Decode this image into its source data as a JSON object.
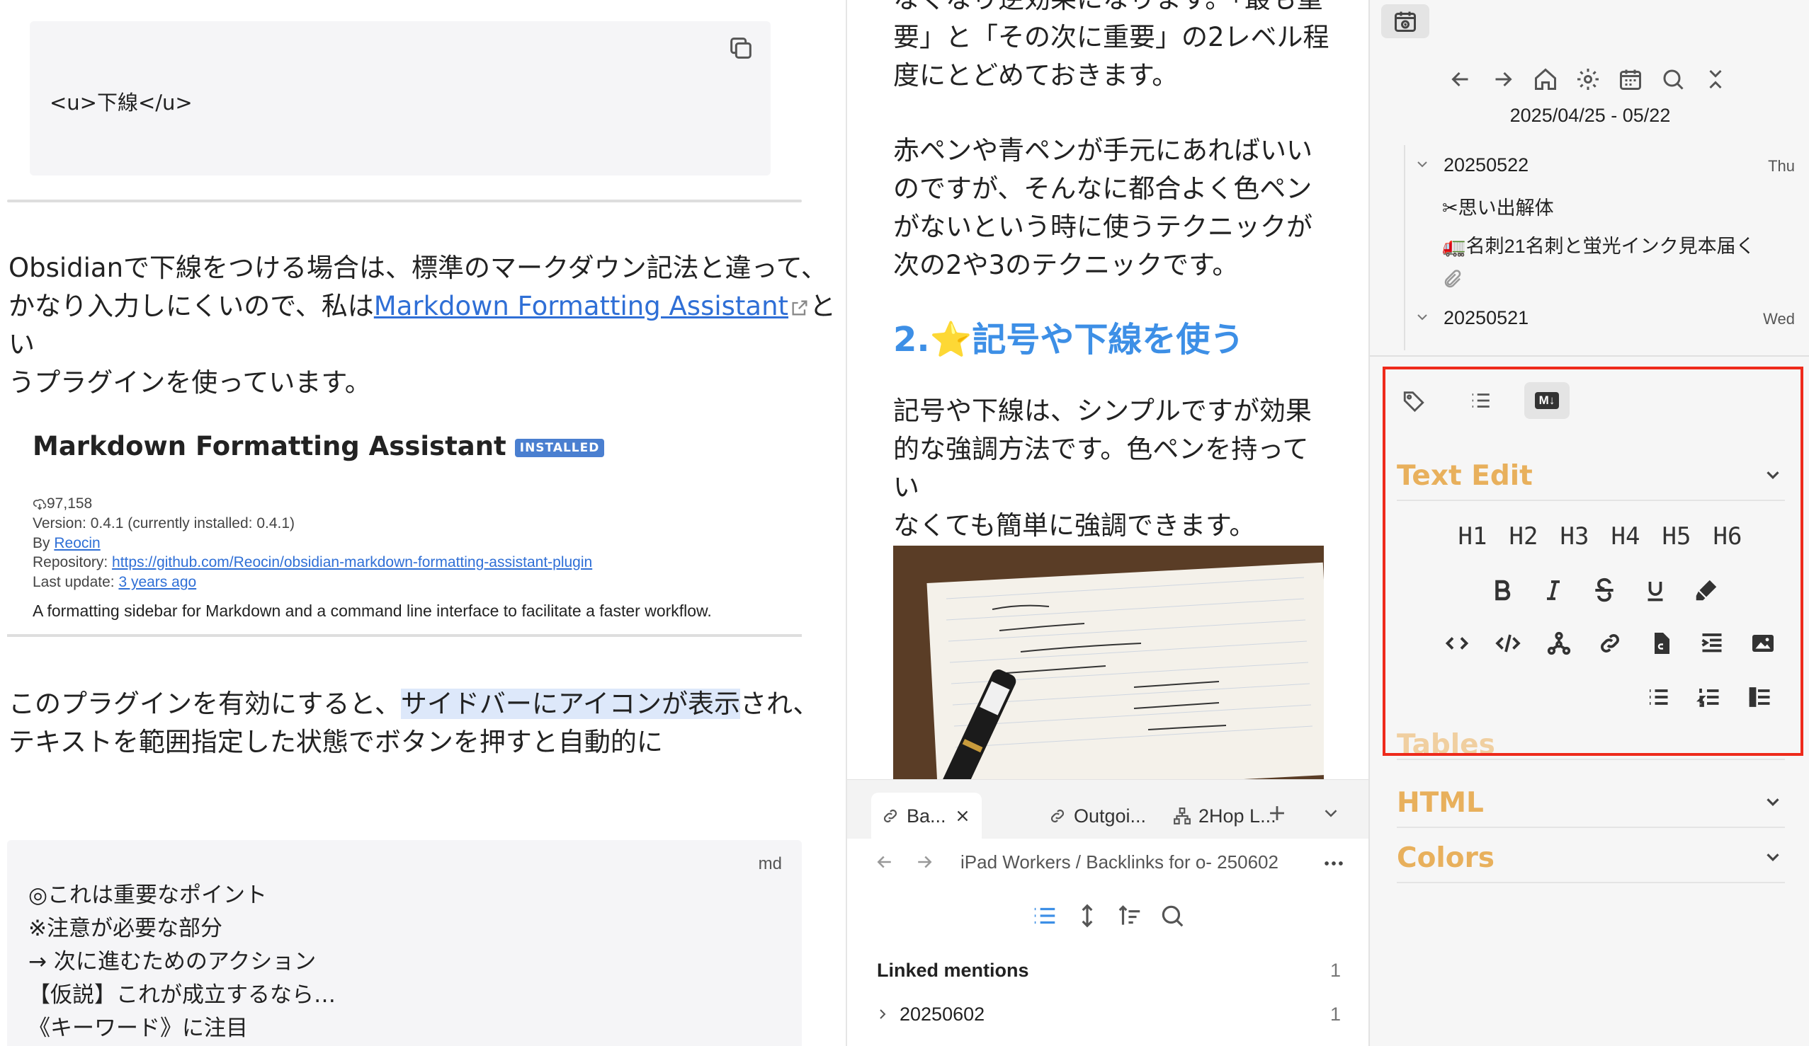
{
  "left": {
    "code1": "<u>下線</u>",
    "para1_a": "Obsidianで下線をつける場合は、標準のマークダウン記法と違って、",
    "para1_b": "かなり入力しにくいので、私は",
    "para1_link": "Markdown Formatting Assistant",
    "para1_c": "とい",
    "para1_d": "うプラグインを使っています。",
    "plugin": {
      "title": "Markdown Formatting Assistant",
      "badge": "INSTALLED",
      "downloads": "97,158",
      "version": "Version: 0.4.1 (currently installed: 0.4.1)",
      "by_label": "By ",
      "by_link": "Reocin",
      "repo_label": "Repository: ",
      "repo_link": "https://github.com/Reocin/obsidian-markdown-formatting-assistant-plugin",
      "update_label": "Last update: ",
      "update_link": "3 years ago",
      "description": "A formatting sidebar for Markdown and a command line interface to facilitate a faster workflow."
    },
    "para2_a": "このプラグインを有効にすると、",
    "para2_hl": "サイドバーにアイコンが表示",
    "para2_b": "され、",
    "para2_c": "テキストを範囲指定した状態でボタンを押すと自動的に",
    "code2": {
      "lang": "md",
      "lines": [
        "◎これは重要なポイント",
        "※注意が必要な部分",
        "→ 次に進むためのアクション",
        "【仮説】これが成立するなら…",
        "《キーワード》に注目"
      ]
    }
  },
  "middle": {
    "top_lines": [
      "なくなり逆効果になります。「最も重",
      "要」と「その次に重要」の2レベル程",
      "度にとどめておきます。"
    ],
    "para_lines": [
      "赤ペンや青ペンが手元にあればいい",
      "のですが、そんなに都合よく色ペン",
      "がないという時に使うテクニックが",
      "次の2や3のテクニックです。"
    ],
    "heading": "2.⭐記号や下線を使う",
    "para2_lines": [
      "記号や下線は、シンプルですが効果",
      "的な強調方法です。色ペンを持ってい",
      "なくても簡単に強調できます。"
    ],
    "tabs": [
      "Ba...",
      "Outgoi...",
      "2Hop L..."
    ],
    "breadcrumb": "iPad Workers / Backlinks for o- 250602",
    "linked_mentions": "Linked mentions",
    "linked_count": "1",
    "mention_item": "20250602",
    "mention_count": "1"
  },
  "right": {
    "date_range": "2025/04/25 - 05/22",
    "day1": "20250522",
    "day1_wd": "Thu",
    "item1": "✂思い出解体",
    "item2": "🚛名刺21名刺と蛍光インク見本届く",
    "day2": "20250521",
    "day2_wd": "Wed",
    "section_text_edit": "Text Edit",
    "headings": [
      "H1",
      "H2",
      "H3",
      "H4",
      "H5",
      "H6"
    ],
    "section_tables": "Tables",
    "section_html": "HTML",
    "section_colors": "Colors",
    "md_badge": "M↓"
  }
}
